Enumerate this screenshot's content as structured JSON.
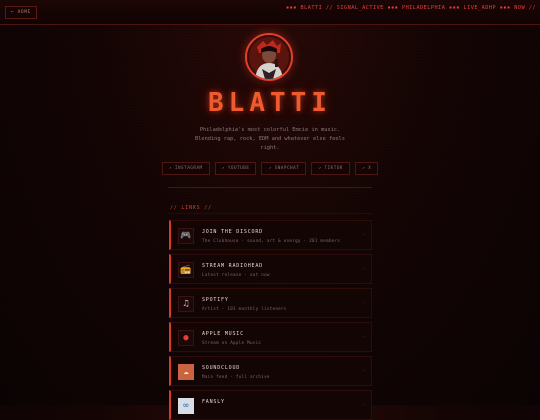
{
  "nav": {
    "home_label": "← HOME"
  },
  "ticker": "▪▪▪ BLATTI // SIGNAL_ACTIVE ▪▪▪ PHILADELPHIA ▪▪▪ LIVE_ADHP ▪▪▪ NOW //",
  "profile": {
    "name": "BLATTI",
    "bio_line1": "Philadelphia's most colorful Emcie in music.",
    "bio_line2": "Blending rap, rock, EDM and whatever else feels",
    "bio_line3": "right."
  },
  "socials": [
    {
      "label": "↗ INSTAGRAM",
      "icon": "instagram"
    },
    {
      "label": "↗ YOUTUBE",
      "icon": "youtube"
    },
    {
      "label": "↗ SNAPCHAT",
      "icon": "snapchat"
    },
    {
      "label": "↗ TIKTOK",
      "icon": "tiktok"
    },
    {
      "label": "↗ X",
      "icon": "x"
    }
  ],
  "links_header": "// LINKS //",
  "links": [
    {
      "title": "JOIN THE DISCORD",
      "desc": "The Clubhouse · sound, art & energy · 201 members",
      "icon_glyph": "🎮",
      "icon": "gamepad-icon",
      "arrow": "→"
    },
    {
      "title": "STREAM RADIOHEAD",
      "desc": "Latest release · out now",
      "icon_glyph": "📻",
      "icon": "radio-icon",
      "arrow": "→"
    },
    {
      "title": "SPOTIFY",
      "desc": "Artist · 101 monthly listeners",
      "icon_glyph": "♫",
      "icon": "music-note-icon",
      "arrow": "→"
    },
    {
      "title": "APPLE MUSIC",
      "desc": "Stream on Apple Music",
      "icon_glyph": "●",
      "icon": "apple-icon",
      "arrow": "→"
    },
    {
      "title": "SOUNDCLOUD",
      "desc": "Main feed · full archive",
      "icon_glyph": "☁",
      "icon": "soundcloud-icon",
      "arrow": "→"
    },
    {
      "title": "FANSLY",
      "desc": "",
      "icon_glyph": "∞",
      "icon": "fansly-icon",
      "arrow": "→"
    }
  ],
  "colors": {
    "accent": "#e0402c",
    "title": "#ef5a2e",
    "background": "#140504"
  }
}
